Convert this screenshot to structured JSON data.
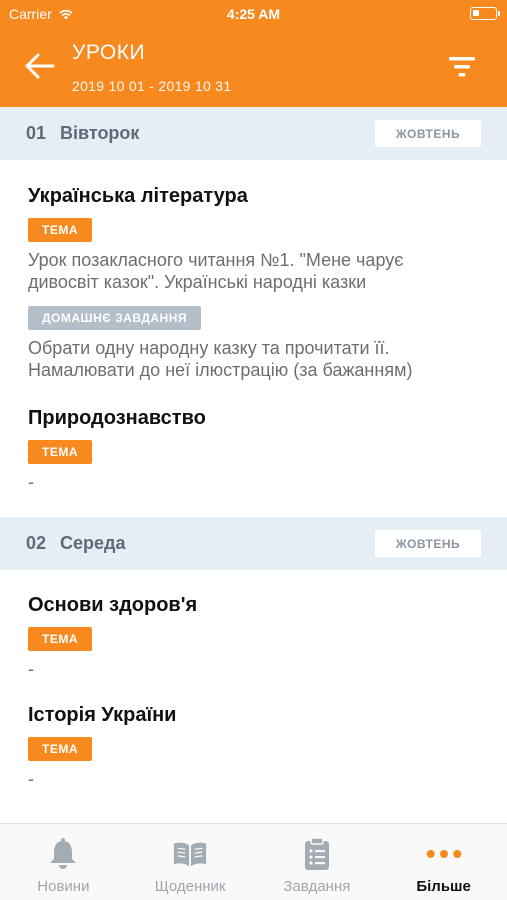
{
  "status_bar": {
    "carrier": "Carrier",
    "time": "4:25 AM"
  },
  "header": {
    "title": "УРОКИ",
    "date_range": "2019 10 01 - 2019 10 31",
    "background_color": "#f7891f"
  },
  "days": [
    {
      "number": "01",
      "name": "Вівторок",
      "month": "ЖОВТЕНЬ",
      "lessons": [
        {
          "title": "Українська література",
          "topic_label": "ТЕМА",
          "topic": "Урок позакласного читання №1. \"Мене чарує дивосвіт казок\". Українські народні казки",
          "homework_label": "ДОМАШНЄ ЗАВДАННЯ",
          "homework": "Обрати одну народну казку та прочитати її. Намалювати до неї ілюстрацію (за бажанням)"
        },
        {
          "title": "Природознавство",
          "topic_label": "ТЕМА",
          "topic": "-"
        }
      ]
    },
    {
      "number": "02",
      "name": "Середа",
      "month": "ЖОВТЕНЬ",
      "lessons": [
        {
          "title": "Основи здоров'я",
          "topic_label": "ТЕМА",
          "topic": "-"
        },
        {
          "title": "Історія України",
          "topic_label": "ТЕМА",
          "topic": "-"
        }
      ]
    }
  ],
  "bottom_nav": [
    {
      "label": "Новини",
      "icon": "bell-icon"
    },
    {
      "label": "Щоденник",
      "icon": "book-icon"
    },
    {
      "label": "Завдання",
      "icon": "clipboard-icon"
    },
    {
      "label": "Більше",
      "icon": "more-dots-icon",
      "active": true
    }
  ]
}
